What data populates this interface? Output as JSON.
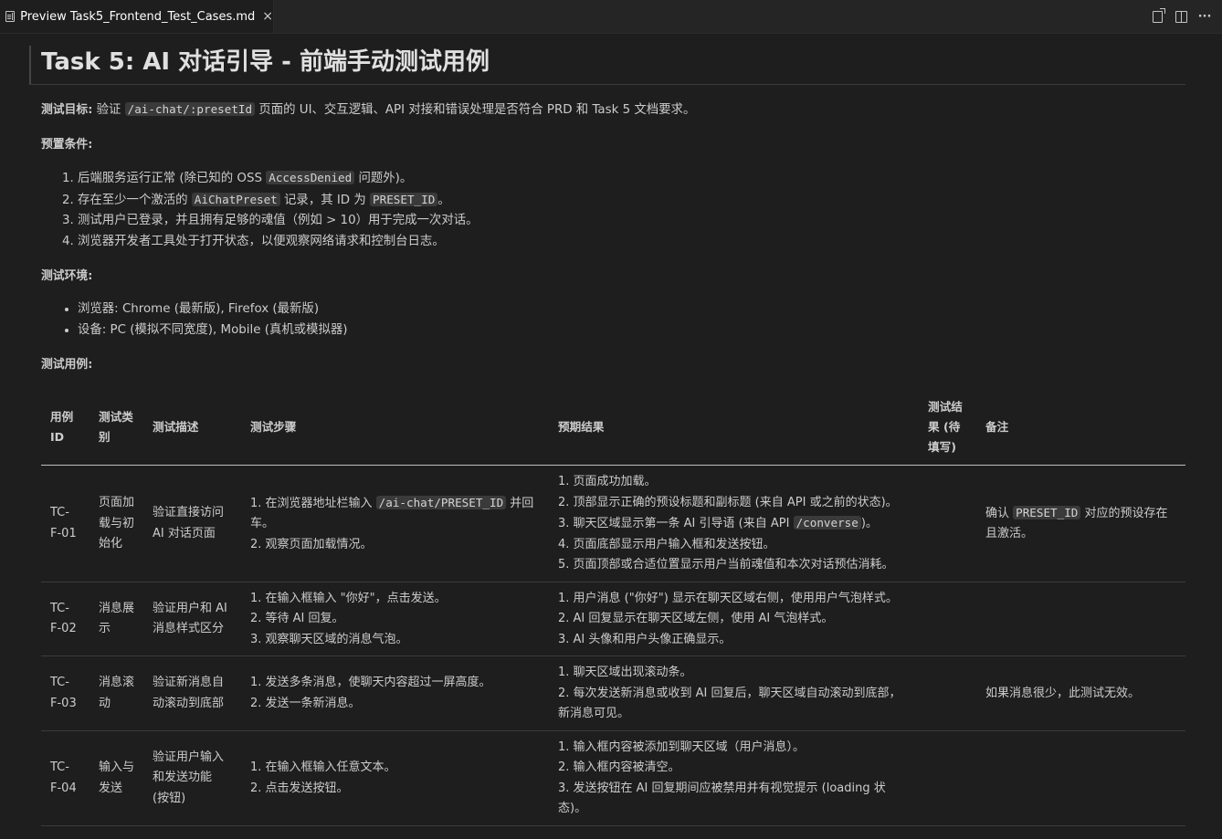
{
  "tab": {
    "title": "Preview Task5_Frontend_Test_Cases.md",
    "close": "×"
  },
  "doc": {
    "title": "Task 5: AI 对话引导 - 前端手动测试用例",
    "goal": {
      "label": "测试目标:",
      "pre": " 验证 ",
      "code": "/ai-chat/:presetId",
      "post": " 页面的 UI、交互逻辑、API 对接和错误处理是否符合 PRD 和 Task 5 文档要求。"
    },
    "preconditions": {
      "label": "预置条件:",
      "items": [
        {
          "pre": "后端服务运行正常 (除已知的 OSS ",
          "code": "AccessDenied",
          "post": " 问题外)。"
        },
        {
          "pre": "存在至少一个激活的 ",
          "code": "AiChatPreset",
          "mid": " 记录，其 ID 为 ",
          "code2": "PRESET_ID",
          "post": "。"
        },
        {
          "pre": "测试用户已登录，并且拥有足够的魂值（例如 > 10）用于完成一次对话。"
        },
        {
          "pre": "浏览器开发者工具处于打开状态，以便观察网络请求和控制台日志。"
        }
      ]
    },
    "env": {
      "label": "测试环境:",
      "items": [
        "浏览器: Chrome (最新版), Firefox (最新版)",
        "设备: PC (模拟不同宽度), Mobile (真机或模拟器)"
      ]
    },
    "cases_label": "测试用例:",
    "table": {
      "headers": [
        "用例 ID",
        "测试类别",
        "测试描述",
        "测试步骤",
        "预期结果",
        "测试结果 (待填写)",
        "备注"
      ],
      "rows": [
        {
          "id": "TC-F-01",
          "category": "页面加载与初始化",
          "desc": "验证直接访问 AI 对话页面",
          "steps": [
            "1. 在浏览器地址栏输入 ",
            "/ai-chat/PRESET_ID",
            " 并回车。",
            "2. 观察页面加载情况。"
          ],
          "expected": [
            "1. 页面成功加载。",
            "2. 顶部显示正确的预设标题和副标题 (来自 API 或之前的状态)。",
            "3. 聊天区域显示第一条 AI 引导语 (来自 API ",
            "/converse",
            ")。",
            "4. 页面底部显示用户输入框和发送按钮。",
            "5. 页面顶部或合适位置显示用户当前魂值和本次对话预估消耗。"
          ],
          "result": "",
          "note": [
            "确认 ",
            "PRESET_ID",
            " 对应的预设存在且激活。"
          ]
        },
        {
          "id": "TC-F-02",
          "category": "消息展示",
          "desc": "验证用户和 AI 消息样式区分",
          "steps": [
            "1. 在输入框输入 \"你好\"，点击发送。",
            "2. 等待 AI 回复。",
            "3. 观察聊天区域的消息气泡。"
          ],
          "expected": [
            "1. 用户消息 (\"你好\") 显示在聊天区域右侧，使用用户气泡样式。",
            "2. AI 回复显示在聊天区域左侧，使用 AI 气泡样式。",
            "3. AI 头像和用户头像正确显示。"
          ],
          "result": "",
          "note": ""
        },
        {
          "id": "TC-F-03",
          "category": "消息滚动",
          "desc": "验证新消息自动滚动到底部",
          "steps": [
            "1. 发送多条消息，使聊天内容超过一屏高度。",
            "2. 发送一条新消息。"
          ],
          "expected": [
            "1. 聊天区域出现滚动条。",
            "2. 每次发送新消息或收到 AI 回复后，聊天区域自动滚动到底部，新消息可见。"
          ],
          "result": "",
          "note": "如果消息很少，此测试无效。"
        },
        {
          "id": "TC-F-04",
          "category": "输入与发送",
          "desc": "验证用户输入和发送功能 (按钮)",
          "steps": [
            "1. 在输入框输入任意文本。",
            "2. 点击发送按钮。"
          ],
          "expected": [
            "1. 输入框内容被添加到聊天区域（用户消息）。",
            "2. 输入框内容被清空。",
            "3. 发送按钮在 AI 回复期间应被禁用并有视觉提示 (loading 状态)。"
          ],
          "result": "",
          "note": ""
        }
      ]
    }
  }
}
